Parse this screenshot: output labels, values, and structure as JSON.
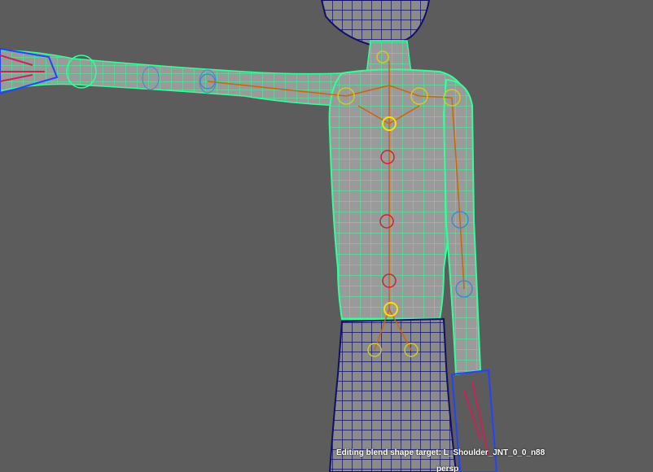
{
  "viewport": {
    "background_color": "#5c5c5c",
    "status_message": "Editing blend shape target: L_Shoulder_JNT_0_0_n88",
    "camera_name": "persp"
  },
  "scene": {
    "character": {
      "mesh_wireframe_color": "#33ff99",
      "shaded_surface_color": "#9a9a9a",
      "pants_wireframe_color": "#101066",
      "head_wireframe_color": "#101066"
    },
    "joints": {
      "bone_color": "#cc6600",
      "bone_selected_color": "#cccc22",
      "spine_joint_color": "#cc2233",
      "selected_joint_color": "#ffdd00",
      "arm_joint_color": "#4488cc",
      "hand_joint_color": "#2244ff"
    }
  }
}
